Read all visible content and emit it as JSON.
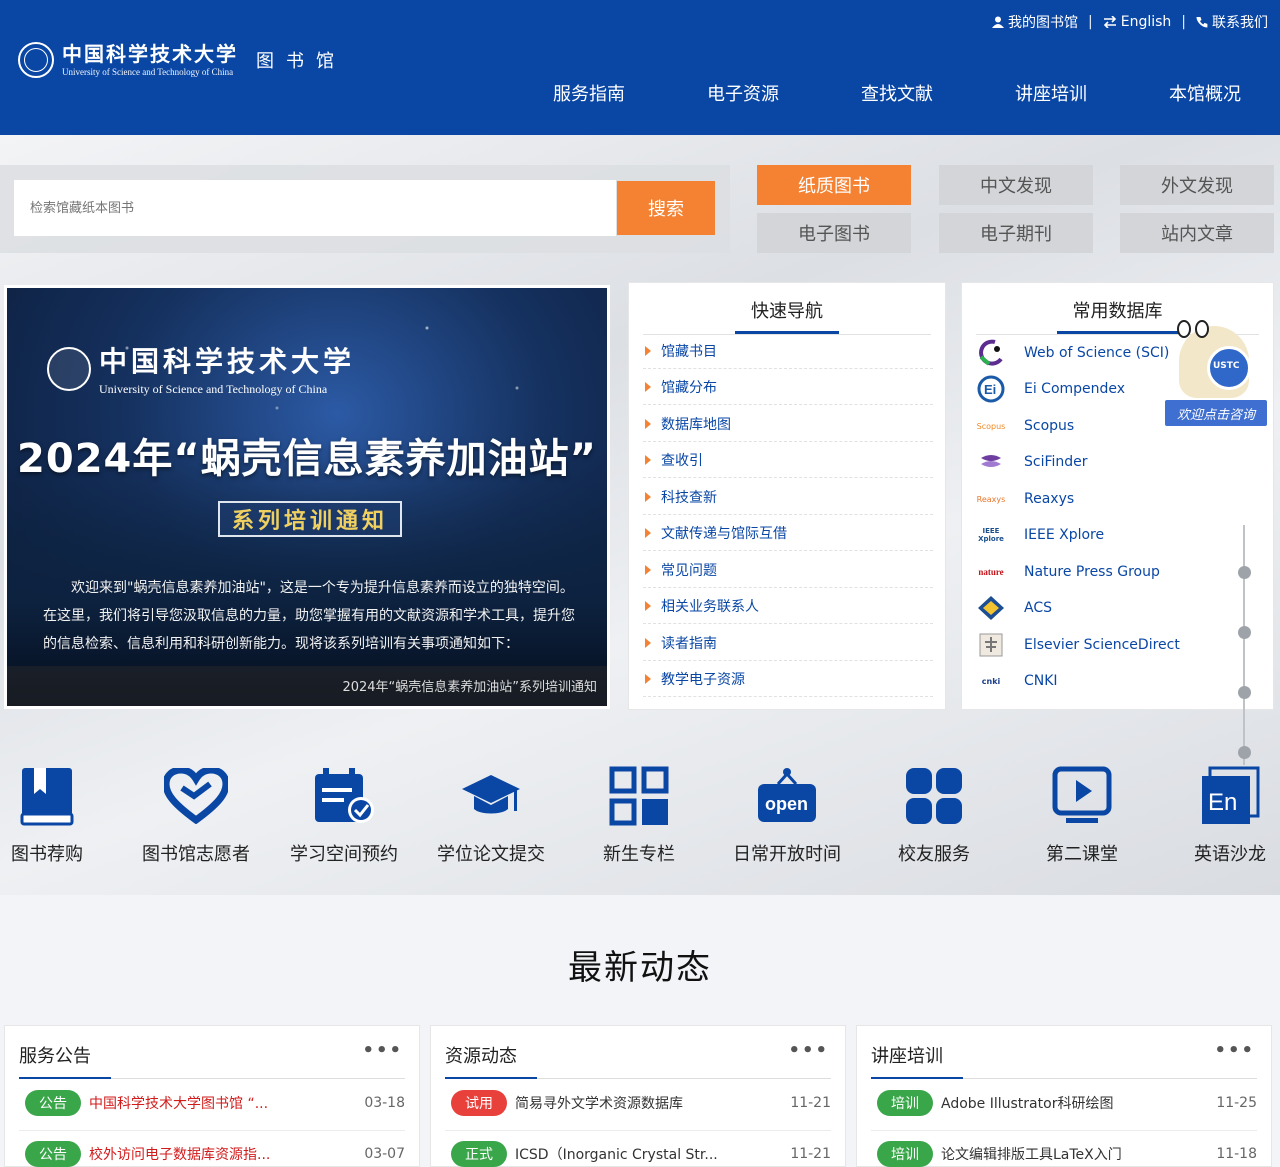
{
  "header": {
    "top_links": {
      "my_library": "我的图书馆",
      "english": "English",
      "contact": "联系我们",
      "sep": "|"
    },
    "logo": {
      "cn": "中国科学技术大学",
      "en": "University of Science and Technology of China",
      "library": "图书馆"
    },
    "nav": [
      "服务指南",
      "电子资源",
      "查找文献",
      "讲座培训",
      "本馆概况"
    ]
  },
  "search": {
    "placeholder": "检索馆藏纸本图书",
    "button": "搜索",
    "types": [
      "纸质图书",
      "中文发现",
      "外文发现",
      "电子图书",
      "电子期刊",
      "站内文章"
    ]
  },
  "banner": {
    "logo_cn": "中国科学技术大学",
    "logo_en": "University of Science and Technology of China",
    "title": "2024年“蜗壳信息素养加油站”",
    "subtitle": "系列培训通知",
    "text": "欢迎来到\"蜗壳信息素养加油站\"，这是一个专为提升信息素养而设立的独特空间。在这里，我们将引导您汲取信息的力量，助您掌握有用的文献资源和学术工具，提升您的信息检索、信息利用和科研创新能力。现将该系列培训有关事项通知如下：",
    "caption": "2024年“蜗壳信息素养加油站”系列培训通知"
  },
  "quick_nav": {
    "title": "快速导航",
    "items": [
      "馆藏书目",
      "馆藏分布",
      "数据库地图",
      "查收引",
      "科技查新",
      "文献传递与馆际互借",
      "常见问题",
      "相关业务联系人",
      "读者指南",
      "教学电子资源"
    ]
  },
  "databases": {
    "title": "常用数据库",
    "items": [
      {
        "name": "Web of Science (SCI)",
        "logo": "wos-logo",
        "logo_text": ""
      },
      {
        "name": "Ei Compendex",
        "logo": "ei-logo",
        "logo_text": ""
      },
      {
        "name": "Scopus",
        "logo": "scopus-logo",
        "logo_text": "Scopus"
      },
      {
        "name": "SciFinder",
        "logo": "scifinder-logo",
        "logo_text": ""
      },
      {
        "name": "Reaxys",
        "logo": "reaxys-logo",
        "logo_text": "Reaxys"
      },
      {
        "name": "IEEE Xplore",
        "logo": "ieee-logo",
        "logo_text": "IEEE Xplore"
      },
      {
        "name": "Nature Press Group",
        "logo": "nature-logo",
        "logo_text": "nature"
      },
      {
        "name": "ACS",
        "logo": "acs-logo",
        "logo_text": ""
      },
      {
        "name": "Elsevier ScienceDirect",
        "logo": "elsevier-logo",
        "logo_text": ""
      },
      {
        "name": "CNKI",
        "logo": "cnki-logo",
        "logo_text": "cnki"
      }
    ],
    "mascot_text": "欢迎点击咨询",
    "mascot_badge": "USTC"
  },
  "services": [
    {
      "label": "图书荐购",
      "icon": "book-icon"
    },
    {
      "label": "图书馆志愿者",
      "icon": "heart-icon"
    },
    {
      "label": "学习空间预约",
      "icon": "calendar-check-icon"
    },
    {
      "label": "学位论文提交",
      "icon": "graduation-cap-icon"
    },
    {
      "label": "新生专栏",
      "icon": "grid-icon"
    },
    {
      "label": "日常开放时间",
      "icon": "open-sign-icon"
    },
    {
      "label": "校友服务",
      "icon": "four-squares-icon"
    },
    {
      "label": "第二课堂",
      "icon": "video-play-icon"
    },
    {
      "label": "英语沙龙",
      "icon": "english-en-icon"
    }
  ],
  "news": {
    "heading": "最新动态",
    "more": "•••",
    "cards": [
      {
        "title": "服务公告",
        "rows": [
          {
            "tag": "公告",
            "text": "中国科学技术大学图书馆 “...",
            "date": "03-18"
          },
          {
            "tag": "公告",
            "text": "校外访问电子数据库资源指...",
            "date": "03-07"
          }
        ]
      },
      {
        "title": "资源动态",
        "rows": [
          {
            "tag": "试用",
            "text": "简易寻外文学术资源数据库",
            "date": "11-21"
          },
          {
            "tag": "正式",
            "text": "ICSD（Inorganic Crystal Str...",
            "date": "11-21"
          }
        ]
      },
      {
        "title": "讲座培训",
        "rows": [
          {
            "tag": "培训",
            "text": "Adobe Illustrator科研绘图",
            "date": "11-25"
          },
          {
            "tag": "培训",
            "text": "论文编辑排版工具LaTeX入门",
            "date": "11-18"
          }
        ]
      }
    ]
  },
  "colors": {
    "brand_blue": "#0a47a5",
    "accent_orange": "#f58232",
    "tag_green": "#3aa64a",
    "tag_red": "#e8413c"
  }
}
